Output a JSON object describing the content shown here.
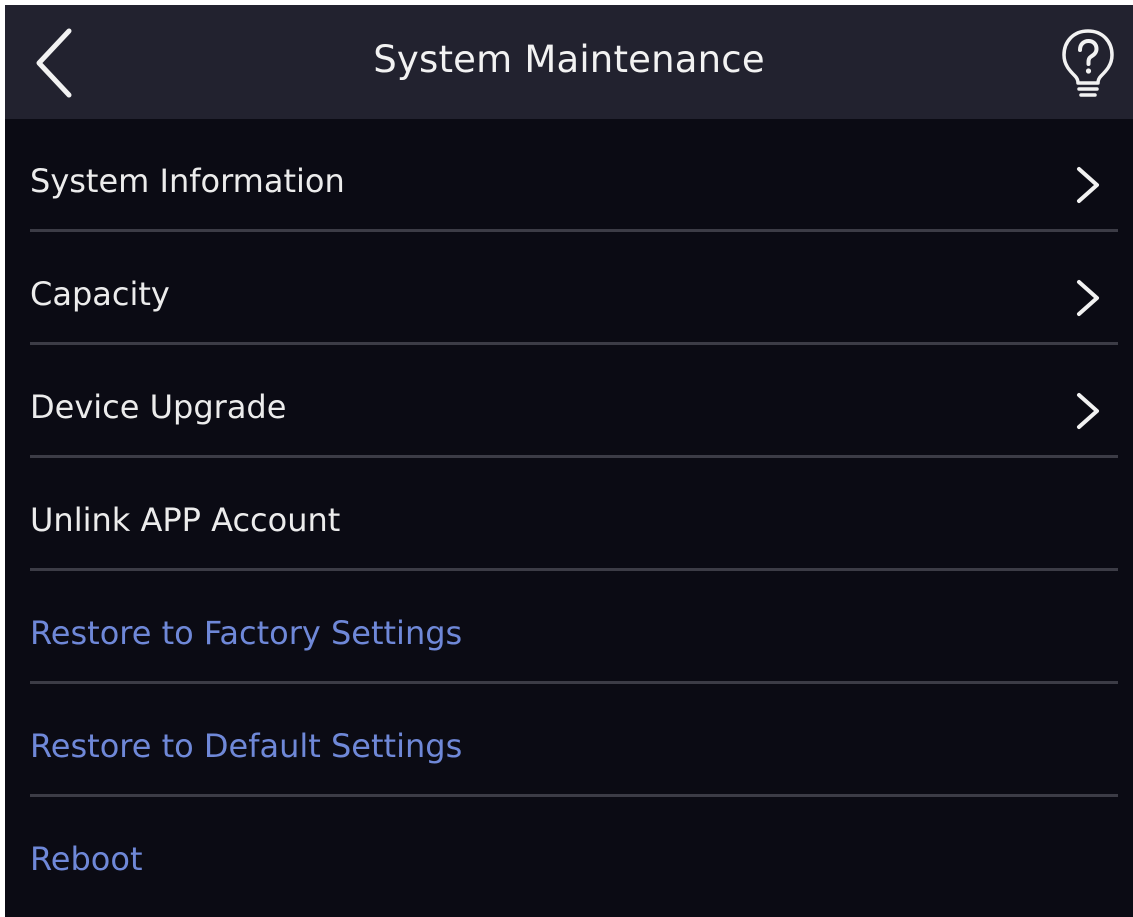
{
  "header": {
    "title": "System Maintenance",
    "back_icon": "chevron-left-icon",
    "help_icon": "help-bulb-icon"
  },
  "menu": {
    "items": [
      {
        "label": "System Information",
        "has_chevron": true,
        "kind": "nav"
      },
      {
        "label": "Capacity",
        "has_chevron": true,
        "kind": "nav"
      },
      {
        "label": "Device Upgrade",
        "has_chevron": true,
        "kind": "nav"
      },
      {
        "label": "Unlink APP Account",
        "has_chevron": false,
        "kind": "nav"
      },
      {
        "label": "Restore to Factory Settings",
        "has_chevron": false,
        "kind": "action"
      },
      {
        "label": "Restore to Default Settings",
        "has_chevron": false,
        "kind": "action"
      },
      {
        "label": "Reboot",
        "has_chevron": false,
        "kind": "action"
      }
    ]
  },
  "colors": {
    "background": "#0b0b14",
    "header_background": "#22222f",
    "text": "#ececec",
    "action_text": "#6f88d8",
    "divider": "#3c3c46"
  }
}
